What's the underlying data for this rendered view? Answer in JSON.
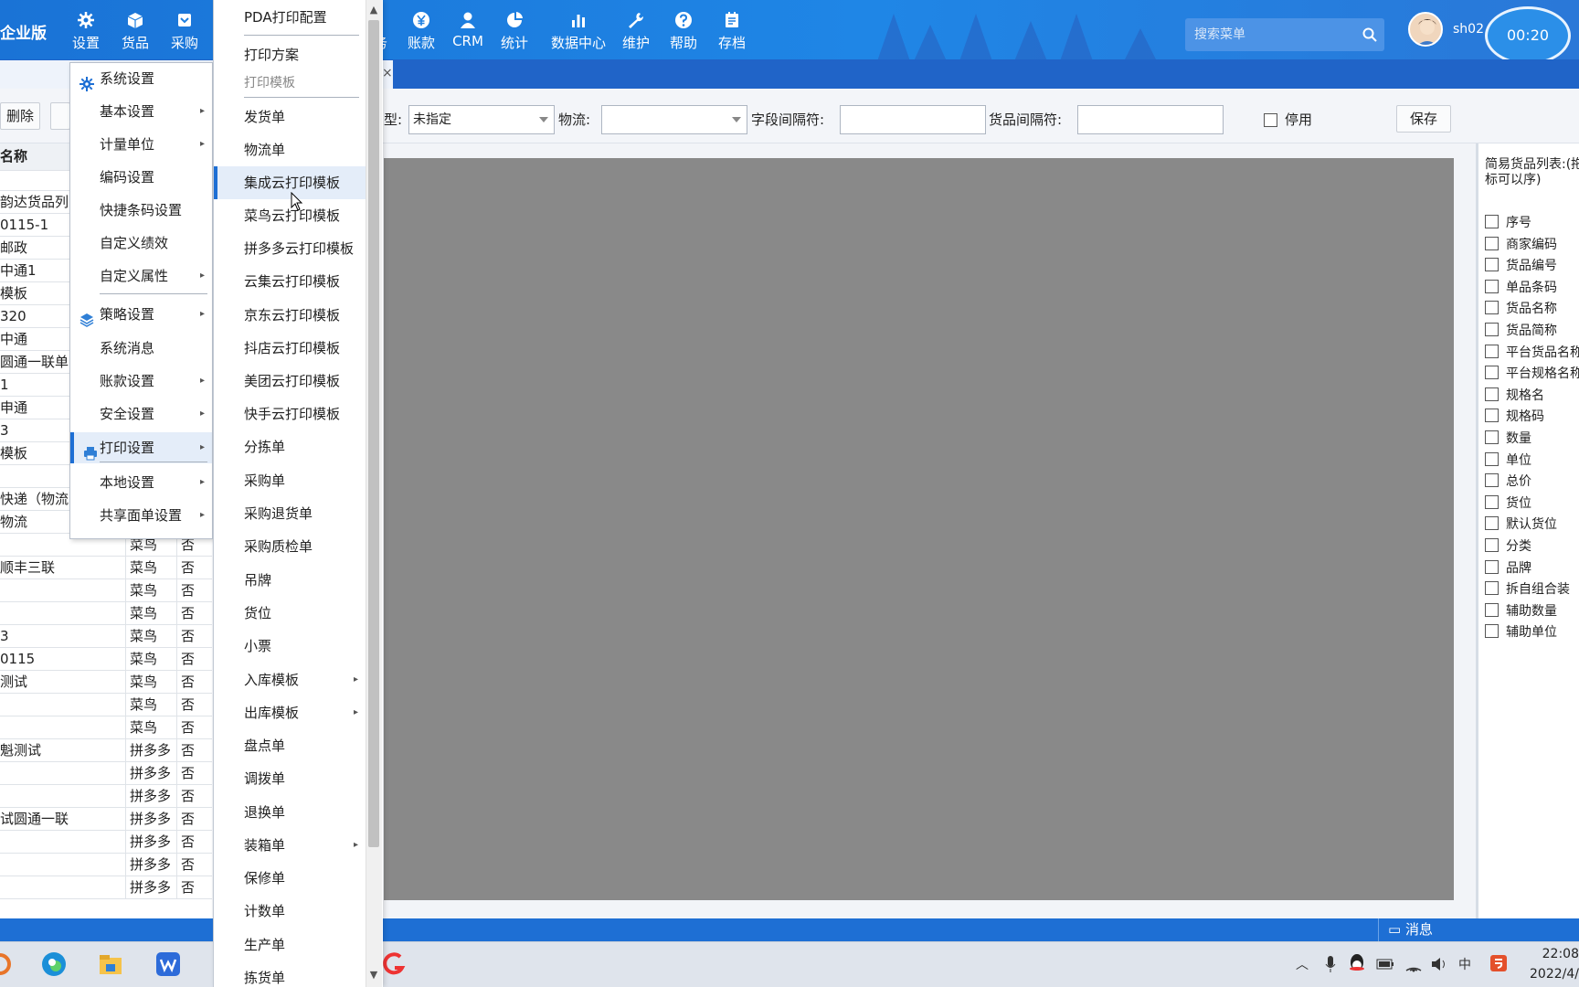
{
  "header": {
    "brand": "企业版",
    "nav": [
      {
        "label": "设置",
        "icon": "gear-icon"
      },
      {
        "label": "货品",
        "icon": "box-icon"
      },
      {
        "label": "采购",
        "icon": "purchase-icon"
      },
      {
        "label": "事务",
        "icon": "chat-icon"
      },
      {
        "label": "账款",
        "icon": "yen-icon"
      },
      {
        "label": "CRM",
        "icon": "user-icon"
      },
      {
        "label": "统计",
        "icon": "pie-chart-icon"
      },
      {
        "label": "数据中心",
        "icon": "bar-chart-icon"
      },
      {
        "label": "维护",
        "icon": "wrench-icon"
      },
      {
        "label": "帮助",
        "icon": "help-icon"
      },
      {
        "label": "存档",
        "icon": "archive-icon"
      }
    ],
    "search_placeholder": "搜索菜单",
    "username": "sh02",
    "timer": "00:20"
  },
  "toolbar": {
    "delete_label": "删除",
    "type_label": "型:",
    "type_value": "未指定",
    "logistics_label": "物流:",
    "logistics_value": "",
    "field_sep_label": "字段间隔符:",
    "field_sep_value": "",
    "goods_sep_label": "货品间隔符:",
    "goods_sep_value": "",
    "disable_label": "停用",
    "save_label": "保存"
  },
  "left_table": {
    "header": "名称",
    "rows": [
      [
        "韵达货品列",
        "",
        ""
      ],
      [
        "0115-1",
        "",
        ""
      ],
      [
        "邮政",
        "",
        ""
      ],
      [
        "中通1",
        "",
        ""
      ],
      [
        "模板",
        "",
        ""
      ],
      [
        "320",
        "",
        ""
      ],
      [
        "中通",
        "",
        ""
      ],
      [
        "圆通一联单",
        "",
        ""
      ],
      [
        "1",
        "",
        ""
      ],
      [
        "申通",
        "",
        ""
      ],
      [
        "3",
        "",
        ""
      ],
      [
        "模板",
        "",
        ""
      ],
      [
        "",
        "",
        ""
      ],
      [
        "快递（物流",
        "",
        ""
      ],
      [
        "物流",
        "菜鸟",
        "否"
      ],
      [
        "",
        "菜鸟",
        "否"
      ],
      [
        "顺丰三联",
        "菜鸟",
        "否"
      ],
      [
        "",
        "菜鸟",
        "否"
      ],
      [
        "",
        "菜鸟",
        "否"
      ],
      [
        "3",
        "菜鸟",
        "否"
      ],
      [
        "0115",
        "菜鸟",
        "否"
      ],
      [
        "测试",
        "菜鸟",
        "否"
      ],
      [
        "",
        "菜鸟",
        "否"
      ],
      [
        "",
        "菜鸟",
        "否"
      ],
      [
        "魁测试",
        "拼多多",
        "否"
      ],
      [
        "",
        "拼多多",
        "否"
      ],
      [
        "",
        "拼多多",
        "否"
      ],
      [
        "试圆通一联",
        "拼多多",
        "否"
      ],
      [
        "",
        "拼多多",
        "否"
      ],
      [
        "",
        "拼多多",
        "否"
      ],
      [
        "",
        "拼多多",
        "否"
      ]
    ]
  },
  "right_panel": {
    "title": "简易货品列表:(拖拽鼠标可以序)",
    "items": [
      "序号",
      "商家编码",
      "货品编号",
      "单品条码",
      "货品名称",
      "货品简称",
      "平台货品名称",
      "平台规格名称",
      "规格名",
      "规格码",
      "数量",
      "单位",
      "总价",
      "货位",
      "默认货位",
      "分类",
      "品牌",
      "拆自组合装",
      "辅助数量",
      "辅助单位"
    ]
  },
  "settings_menu": {
    "items": [
      {
        "label": "系统设置",
        "icon": "gear-icon",
        "arrow": false
      },
      {
        "label": "基本设置",
        "arrow": true
      },
      {
        "label": "计量单位",
        "arrow": true
      },
      {
        "label": "编码设置",
        "arrow": false
      },
      {
        "label": "快捷条码设置",
        "arrow": false
      },
      {
        "label": "自定义绩效",
        "arrow": false
      },
      {
        "label": "自定义属性",
        "arrow": true
      },
      {
        "label": "策略设置",
        "icon": "layers-icon",
        "arrow": true
      },
      {
        "label": "系统消息",
        "arrow": false
      },
      {
        "label": "账款设置",
        "arrow": true
      },
      {
        "label": "安全设置",
        "arrow": true
      },
      {
        "label": "打印设置",
        "icon": "printer-icon",
        "arrow": true
      },
      {
        "label": "本地设置",
        "arrow": true
      },
      {
        "label": "共享面单设置",
        "arrow": true
      }
    ]
  },
  "print_menu": {
    "items": [
      {
        "label": "PDA打印配置"
      },
      {
        "label": "打印方案"
      },
      {
        "label": "打印模板",
        "group": true
      },
      {
        "label": "发货单"
      },
      {
        "label": "物流单"
      },
      {
        "label": "集成云打印模板",
        "highlight": true
      },
      {
        "label": "菜鸟云打印模板"
      },
      {
        "label": "拼多多云打印模板"
      },
      {
        "label": "云集云打印模板"
      },
      {
        "label": "京东云打印模板"
      },
      {
        "label": "抖店云打印模板"
      },
      {
        "label": "美团云打印模板"
      },
      {
        "label": "快手云打印模板"
      },
      {
        "label": "分拣单"
      },
      {
        "label": "采购单"
      },
      {
        "label": "采购退货单"
      },
      {
        "label": "采购质检单"
      },
      {
        "label": "吊牌"
      },
      {
        "label": "货位"
      },
      {
        "label": "小票"
      },
      {
        "label": "入库模板",
        "arrow": true
      },
      {
        "label": "出库模板",
        "arrow": true
      },
      {
        "label": "盘点单"
      },
      {
        "label": "调拨单"
      },
      {
        "label": "退换单"
      },
      {
        "label": "装箱单",
        "arrow": true
      },
      {
        "label": "保修单"
      },
      {
        "label": "计数单"
      },
      {
        "label": "生产单"
      },
      {
        "label": "拣货单"
      }
    ]
  },
  "statusbar": {
    "message_label": "消息"
  },
  "taskbar": {
    "time": "22:08",
    "date": "2022/4/",
    "ime": "中"
  }
}
